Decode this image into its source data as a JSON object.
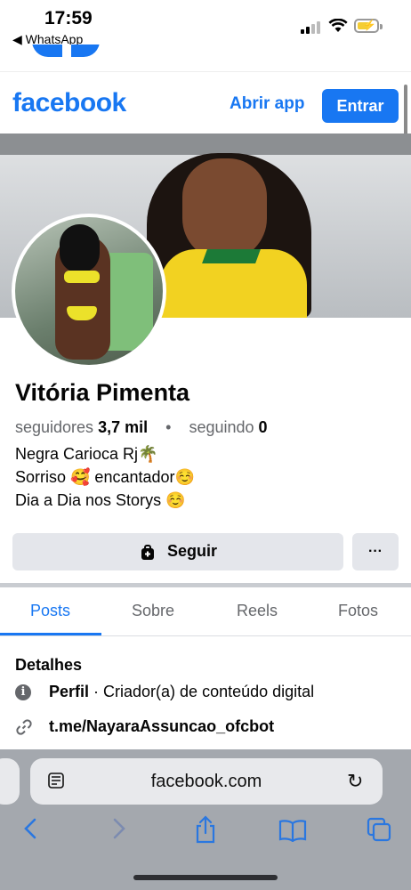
{
  "status_bar": {
    "time": "17:59",
    "back_app": "◀ WhatsApp"
  },
  "header": {
    "logo": "facebook",
    "open_app": "Abrir app",
    "login": "Entrar"
  },
  "profile": {
    "name": "Vitória Pimenta",
    "followers_label": "seguidores",
    "followers_count": "3,7 mil",
    "following_label": "seguindo",
    "following_count": "0",
    "bio": [
      "Negra Carioca Rj🌴",
      "Sorriso 🥰 encantador☺️",
      "Dia a Dia nos Storys ☺️"
    ]
  },
  "actions": {
    "follow": "Seguir",
    "more": "···"
  },
  "tabs": [
    {
      "label": "Posts",
      "active": true
    },
    {
      "label": "Sobre",
      "active": false
    },
    {
      "label": "Reels",
      "active": false
    },
    {
      "label": "Fotos",
      "active": false
    }
  ],
  "details": {
    "title": "Detalhes",
    "profile_label": "Perfil",
    "profile_value": " · Criador(a) de conteúdo digital",
    "link": "t.me/NayaraAssuncao_ofcbot"
  },
  "browser": {
    "url": "facebook.com"
  },
  "colors": {
    "brand": "#1877f2",
    "secondary_text": "#65676b",
    "button_bg": "#e4e6eb"
  }
}
